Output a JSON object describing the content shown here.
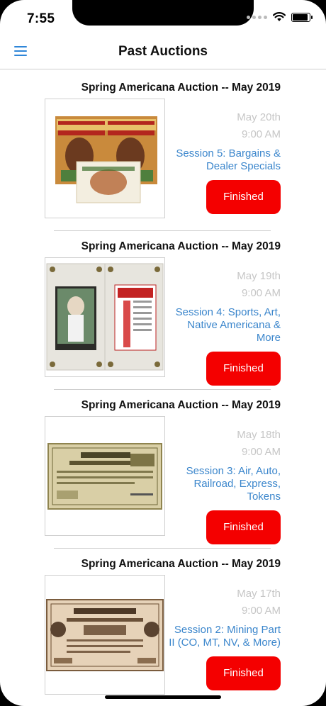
{
  "status_bar": {
    "time": "7:55",
    "battery_level": 0.9
  },
  "navbar": {
    "title": "Past Auctions",
    "menu_icon": "hamburger-menu-icon"
  },
  "colors": {
    "accent": "#3b86cc",
    "finished": "#f40000",
    "muted": "#c6c6c6"
  },
  "auctions": [
    {
      "title": "Spring Americana Auction -- May 2019",
      "date": "May 20th",
      "time": "9:00 AM",
      "session": "Session 5: Bargains & Dealer Specials",
      "status": "Finished",
      "image": "tobacco-label-lot-image"
    },
    {
      "title": "Spring Americana Auction -- May 2019",
      "date": "May 19th",
      "time": "9:00 AM",
      "session": "Session 4: Sports, Art, Native Americana & More",
      "status": "Finished",
      "image": "baseball-card-lot-image"
    },
    {
      "title": "Spring Americana Auction -- May 2019",
      "date": "May 18th",
      "time": "9:00 AM",
      "session": "Session 3: Air, Auto, Railroad, Express, Tokens",
      "status": "Finished",
      "image": "railroad-certificate-lot-image"
    },
    {
      "title": "Spring Americana Auction -- May 2019",
      "date": "May 17th",
      "time": "9:00 AM",
      "session": "Session 2: Mining Part II (CO, MT, NV, & More)",
      "status": "Finished",
      "image": "mining-certificate-lot-image"
    }
  ]
}
